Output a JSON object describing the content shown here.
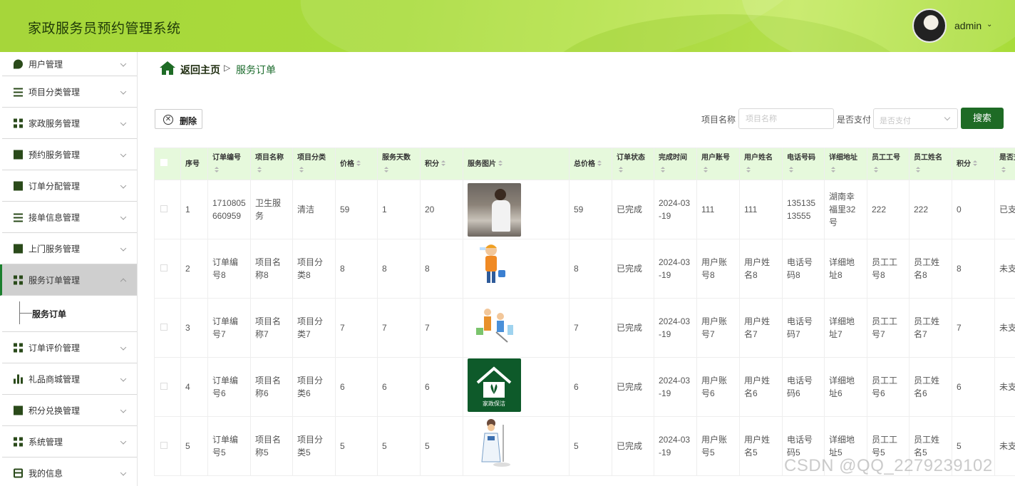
{
  "header": {
    "title": "家政服务员预约管理系统",
    "user": "admin",
    "caret": "⌄"
  },
  "sidebar": {
    "items": [
      {
        "label": "用户管理",
        "icon": "location-pin-icon"
      },
      {
        "label": "项目分类管理",
        "icon": "clipboard-icon"
      },
      {
        "label": "家政服务管理",
        "icon": "grid-icon"
      },
      {
        "label": "预约服务管理",
        "icon": "calendar-x-icon"
      },
      {
        "label": "订单分配管理",
        "icon": "monitor-icon"
      },
      {
        "label": "接单信息管理",
        "icon": "sliders-icon"
      },
      {
        "label": "上门服务管理",
        "icon": "ticket-icon"
      },
      {
        "label": "服务订单管理",
        "icon": "grid-icon",
        "active": true
      },
      {
        "label": "订单评价管理",
        "icon": "grid-icon"
      },
      {
        "label": "礼品商城管理",
        "icon": "bar-chart-icon"
      },
      {
        "label": "积分兑换管理",
        "icon": "stamp-icon"
      },
      {
        "label": "系统管理",
        "icon": "grid-icon"
      },
      {
        "label": "我的信息",
        "icon": "id-card-icon"
      }
    ],
    "submenu": "服务订单"
  },
  "breadcrumb": {
    "home": "返回主页",
    "sep": "▷",
    "current": "服务订单"
  },
  "toolbar": {
    "delete_label": "删除",
    "name_label": "项目名称",
    "name_placeholder": "项目名称",
    "paid_label": "是否支付",
    "paid_placeholder": "是否支付",
    "search_label": "搜索"
  },
  "table": {
    "headers": [
      "序号",
      "订单编号",
      "项目名称",
      "项目分类",
      "价格",
      "服务天数",
      "积分",
      "服务图片",
      "总价格",
      "订单状态",
      "完成时间",
      "用户账号",
      "用户姓名",
      "电话号码",
      "详细地址",
      "员工工号",
      "员工姓名",
      "积分",
      "是否支付"
    ],
    "rows": [
      [
        "1",
        "1710805660959",
        "卫生服务",
        "清洁",
        "59",
        "1",
        "20",
        "kitchen",
        "59",
        "已完成",
        "2024-03-19",
        "111",
        "111",
        "13513513555",
        "湖南幸福里32号",
        "222",
        "222",
        "0",
        "已支付"
      ],
      [
        "2",
        "订单编号8",
        "项目名称8",
        "项目分类8",
        "8",
        "8",
        "8",
        "cleaner",
        "8",
        "已完成",
        "2024-03-19",
        "用户账号8",
        "用户姓名8",
        "电话号码8",
        "详细地址8",
        "员工工号8",
        "员工姓名8",
        "8",
        "未支付"
      ],
      [
        "3",
        "订单编号7",
        "项目名称7",
        "项目分类7",
        "7",
        "7",
        "7",
        "family",
        "7",
        "已完成",
        "2024-03-19",
        "用户账号7",
        "用户姓名7",
        "电话号码7",
        "详细地址7",
        "员工工号7",
        "员工姓名7",
        "7",
        "未支付"
      ],
      [
        "4",
        "订单编号6",
        "项目名称6",
        "项目分类6",
        "6",
        "6",
        "6",
        "house",
        "6",
        "已完成",
        "2024-03-19",
        "用户账号6",
        "用户姓名6",
        "电话号码6",
        "详细地址6",
        "员工工号6",
        "员工姓名6",
        "6",
        "未支付"
      ],
      [
        "5",
        "订单编号5",
        "项目名称5",
        "项目分类5",
        "5",
        "5",
        "5",
        "maid",
        "5",
        "已完成",
        "2024-03-19",
        "用户账号5",
        "用户姓名5",
        "电话号码5",
        "详细地址5",
        "员工工号5",
        "员工姓名5",
        "5",
        "未支付"
      ]
    ],
    "house_logo_text": "家政保洁"
  },
  "watermark": "CSDN @QQ_2279239102",
  "colors": {
    "accent": "#1e6b25",
    "header_green": "#a6d63a",
    "table_head": "#e6f9dc"
  }
}
